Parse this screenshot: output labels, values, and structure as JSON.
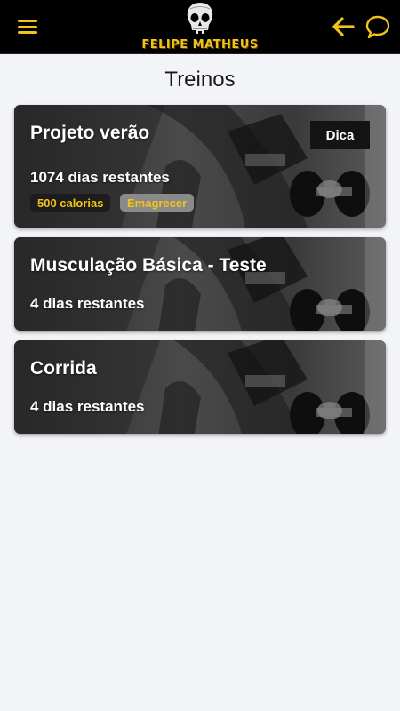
{
  "header": {
    "brand": "FELIPE MATHEUS",
    "menu_icon": "hamburger-menu-icon",
    "back_icon": "arrow-left-icon",
    "chat_icon": "chat-bubble-icon",
    "accent_color": "#f2c318"
  },
  "page": {
    "title": "Treinos"
  },
  "cards": [
    {
      "title": "Projeto verão",
      "days": "1074 dias restantes",
      "button": "Dica",
      "tags": [
        "500 calorias",
        "Emagrecer"
      ]
    },
    {
      "title": "Musculação Básica - Teste",
      "days": "4 dias restantes"
    },
    {
      "title": "Corrida",
      "days": "4 dias restantes"
    }
  ]
}
